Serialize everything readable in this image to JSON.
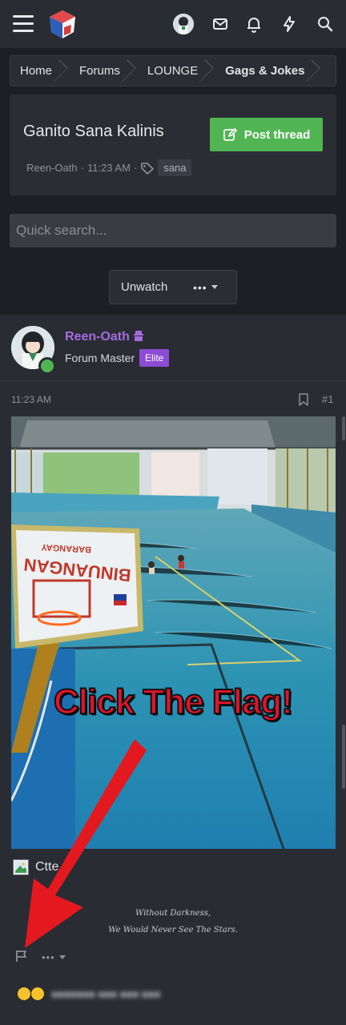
{
  "header": {
    "icons": [
      "menu-icon",
      "site-logo",
      "user-avatar",
      "inbox-icon",
      "alerts-bell-icon",
      "whats-new-bolt-icon",
      "search-icon"
    ]
  },
  "breadcrumb": [
    "Home",
    "Forums",
    "LOUNGE",
    "Gags & Jokes"
  ],
  "thread": {
    "title": "Ganito Sana Kalinis",
    "author": "Reen-Oath",
    "time": "11:23 AM",
    "tag": "sana",
    "post_button": "Post thread"
  },
  "search": {
    "placeholder": "Quick search..."
  },
  "watch": {
    "unwatch_label": "Unwatch",
    "more_label": "•••"
  },
  "post": {
    "username": "Reen-Oath",
    "user_title": "Forum Master",
    "badge": "Elite",
    "time": "11:23 AM",
    "number": "#1",
    "attachment_name": "Ctte",
    "signature_line1": "Without Darkness,",
    "signature_line2": "We Would Never See The Stars.",
    "more_label": "•••"
  },
  "image_overlay": {
    "caption": "Click The Flag!",
    "sign_line1": "BARANGAY",
    "sign_line2": "BINUANGAN"
  },
  "colors": {
    "accent_green": "#52b553",
    "username_purple": "#a56ce0",
    "elite_badge": "#8e4bd6",
    "overlay_red": "#e3132b"
  }
}
